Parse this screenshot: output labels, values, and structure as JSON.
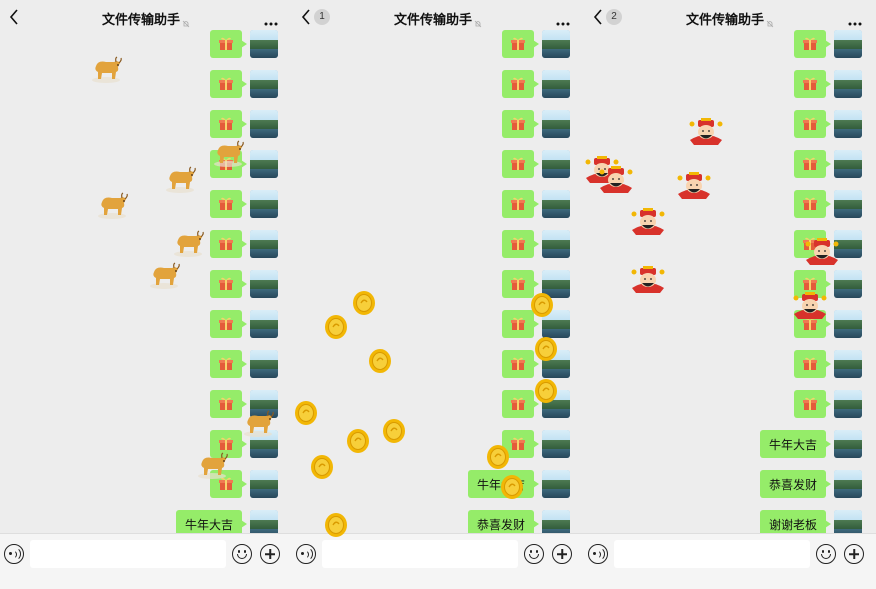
{
  "header": {
    "title": "文件传输助手",
    "panels_unread": [
      "",
      "1",
      "2"
    ]
  },
  "colors": {
    "bubble": "#95ec69",
    "background": "#ededed",
    "bottom_bar": "#f5f5f5",
    "coin": "#f2b705",
    "ox": "#e2a33c",
    "god_red": "#d8322b"
  },
  "icons": {
    "back": "chevron-left-icon",
    "more": "more-dots-icon",
    "voice": "voice-icon",
    "emoji": "emoji-icon",
    "plus": "plus-icon",
    "gift": "gift-icon",
    "mute": "mute-bell-icon"
  },
  "panels": [
    {
      "messages": [
        "",
        "",
        "",
        "",
        "",
        "",
        "",
        "",
        "",
        "",
        "",
        "",
        "牛年大吉"
      ],
      "effect": "ox"
    },
    {
      "messages": [
        "",
        "",
        "",
        "",
        "",
        "",
        "",
        "",
        "",
        "",
        "",
        "牛年大吉",
        "恭喜发财"
      ],
      "effect": "coin"
    },
    {
      "messages": [
        "",
        "",
        "",
        "",
        "",
        "",
        "",
        "",
        "",
        "",
        "牛年大吉",
        "恭喜发财",
        "谢谢老板"
      ],
      "effect": "god"
    }
  ]
}
